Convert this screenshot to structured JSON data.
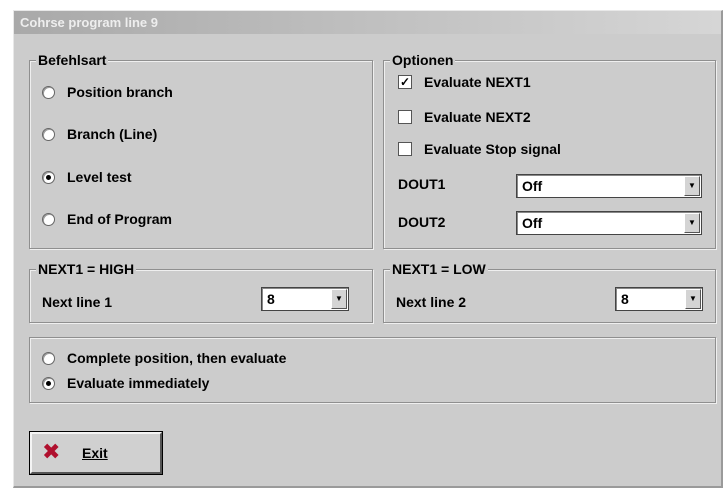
{
  "window": {
    "title": "Cohrse program line 9"
  },
  "befehlsart": {
    "legend": "Befehlsart",
    "options": [
      {
        "label": "Position branch",
        "selected": false
      },
      {
        "label": "Branch (Line)",
        "selected": false
      },
      {
        "label": "Level test",
        "selected": true
      },
      {
        "label": "End of Program",
        "selected": false
      }
    ]
  },
  "optionen": {
    "legend": "Optionen",
    "checks": [
      {
        "label": "Evaluate NEXT1",
        "checked": true
      },
      {
        "label": "Evaluate NEXT2",
        "checked": false
      },
      {
        "label": "Evaluate Stop signal",
        "checked": false
      }
    ],
    "dout1": {
      "label": "DOUT1",
      "value": "Off"
    },
    "dout2": {
      "label": "DOUT2",
      "value": "Off"
    }
  },
  "next_high": {
    "legend": "NEXT1 = HIGH",
    "label": "Next line 1",
    "value": "8"
  },
  "next_low": {
    "legend": "NEXT1 = LOW",
    "label": "Next line 2",
    "value": "8"
  },
  "evaluation": {
    "options": [
      {
        "label": "Complete position, then evaluate",
        "selected": false
      },
      {
        "label": "Evaluate immediately",
        "selected": true
      }
    ]
  },
  "exit_button": {
    "label": "Exit"
  },
  "icons": {
    "dropdown": "chevron-down-icon",
    "exit": "close-icon",
    "exit_color": "#b0102e"
  }
}
